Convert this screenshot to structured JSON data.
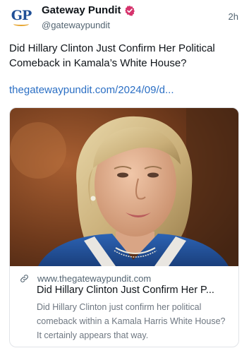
{
  "post": {
    "author_name": "Gateway Pundit",
    "handle": "@gatewaypundit",
    "time": "2h",
    "avatar_text": "GP",
    "text": "Did Hillary Clinton Just Confirm Her Political Comeback in Kamala’s White House?",
    "link_text": "thegatewaypundit.com/2024/09/d...",
    "verified_icon": "verified-badge-icon",
    "accent_color": "#2b6fc4"
  },
  "card": {
    "image_icon": "photo-of-woman",
    "link_icon": "link-icon",
    "domain": "www.thegatewaypundit.com",
    "title": "Did Hillary Clinton Just Confirm Her P...",
    "description": "Did Hillary Clinton just confirm her political comeback within a Kamala Harris White House? It certainly appears that way."
  }
}
